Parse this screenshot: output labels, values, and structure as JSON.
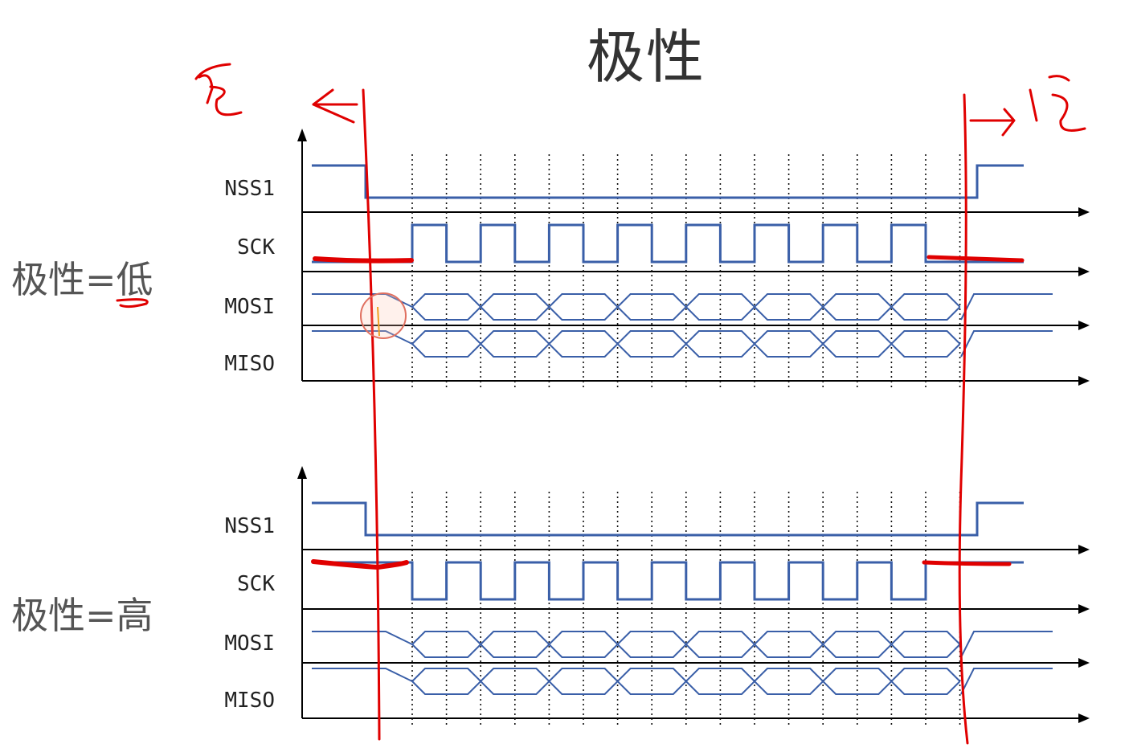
{
  "title": "极性",
  "panels": [
    {
      "label": "极性=低",
      "idle_level": "low",
      "signals": [
        "NSS1",
        "SCK",
        "MOSI",
        "MISO"
      ]
    },
    {
      "label": "极性=高",
      "idle_level": "high",
      "signals": [
        "NSS1",
        "SCK",
        "MOSI",
        "MISO"
      ]
    }
  ],
  "clock_cycles": 8,
  "colors": {
    "waveform": "#3a5fa8",
    "axis": "#000000",
    "annotation": "#e00000",
    "text": "#333333"
  }
}
